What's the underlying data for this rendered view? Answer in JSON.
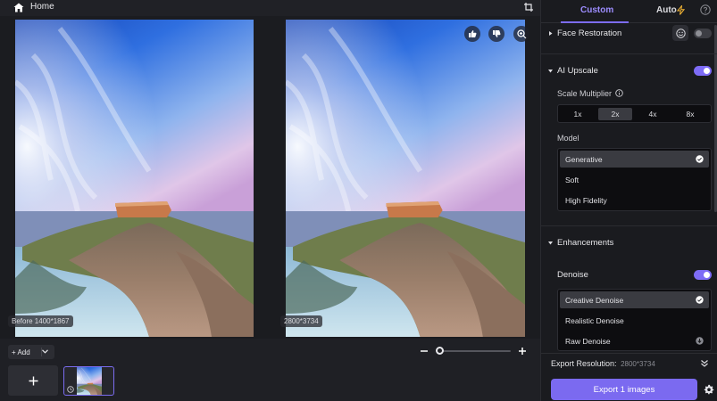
{
  "topbar": {
    "home_label": "Home"
  },
  "before": {
    "resolution": "Before  1400*1867"
  },
  "after": {
    "resolution": "2800*3734"
  },
  "bottom": {
    "add_label": "+ Add"
  },
  "tabs": {
    "custom": "Custom",
    "auto": "Auto"
  },
  "sections": {
    "face_restoration": {
      "label": "Face Restoration",
      "enabled": false
    },
    "ai_upscale": {
      "label": "AI Upscale",
      "enabled": true,
      "scale_label": "Scale Multiplier",
      "scale_options": [
        "1x",
        "2x",
        "4x",
        "8x"
      ],
      "scale_selected": "2x",
      "model_label": "Model",
      "models": [
        "Generative",
        "Soft",
        "High Fidelity"
      ],
      "model_selected": "Generative"
    },
    "enhancements": {
      "label": "Enhancements",
      "denoise_label": "Denoise",
      "denoise_enabled": true,
      "denoise_options": [
        "Creative Denoise",
        "Realistic Denoise",
        "Raw Denoise"
      ],
      "denoise_selected": "Creative Denoise"
    }
  },
  "export": {
    "resolution_label": "Export Resolution:",
    "resolution_value": "2800*3734",
    "button_label": "Export 1 images"
  },
  "colors": {
    "accent": "#7b6af0",
    "panel_bg": "#1a1b1f",
    "canvas_bg": "#1b1c20"
  }
}
